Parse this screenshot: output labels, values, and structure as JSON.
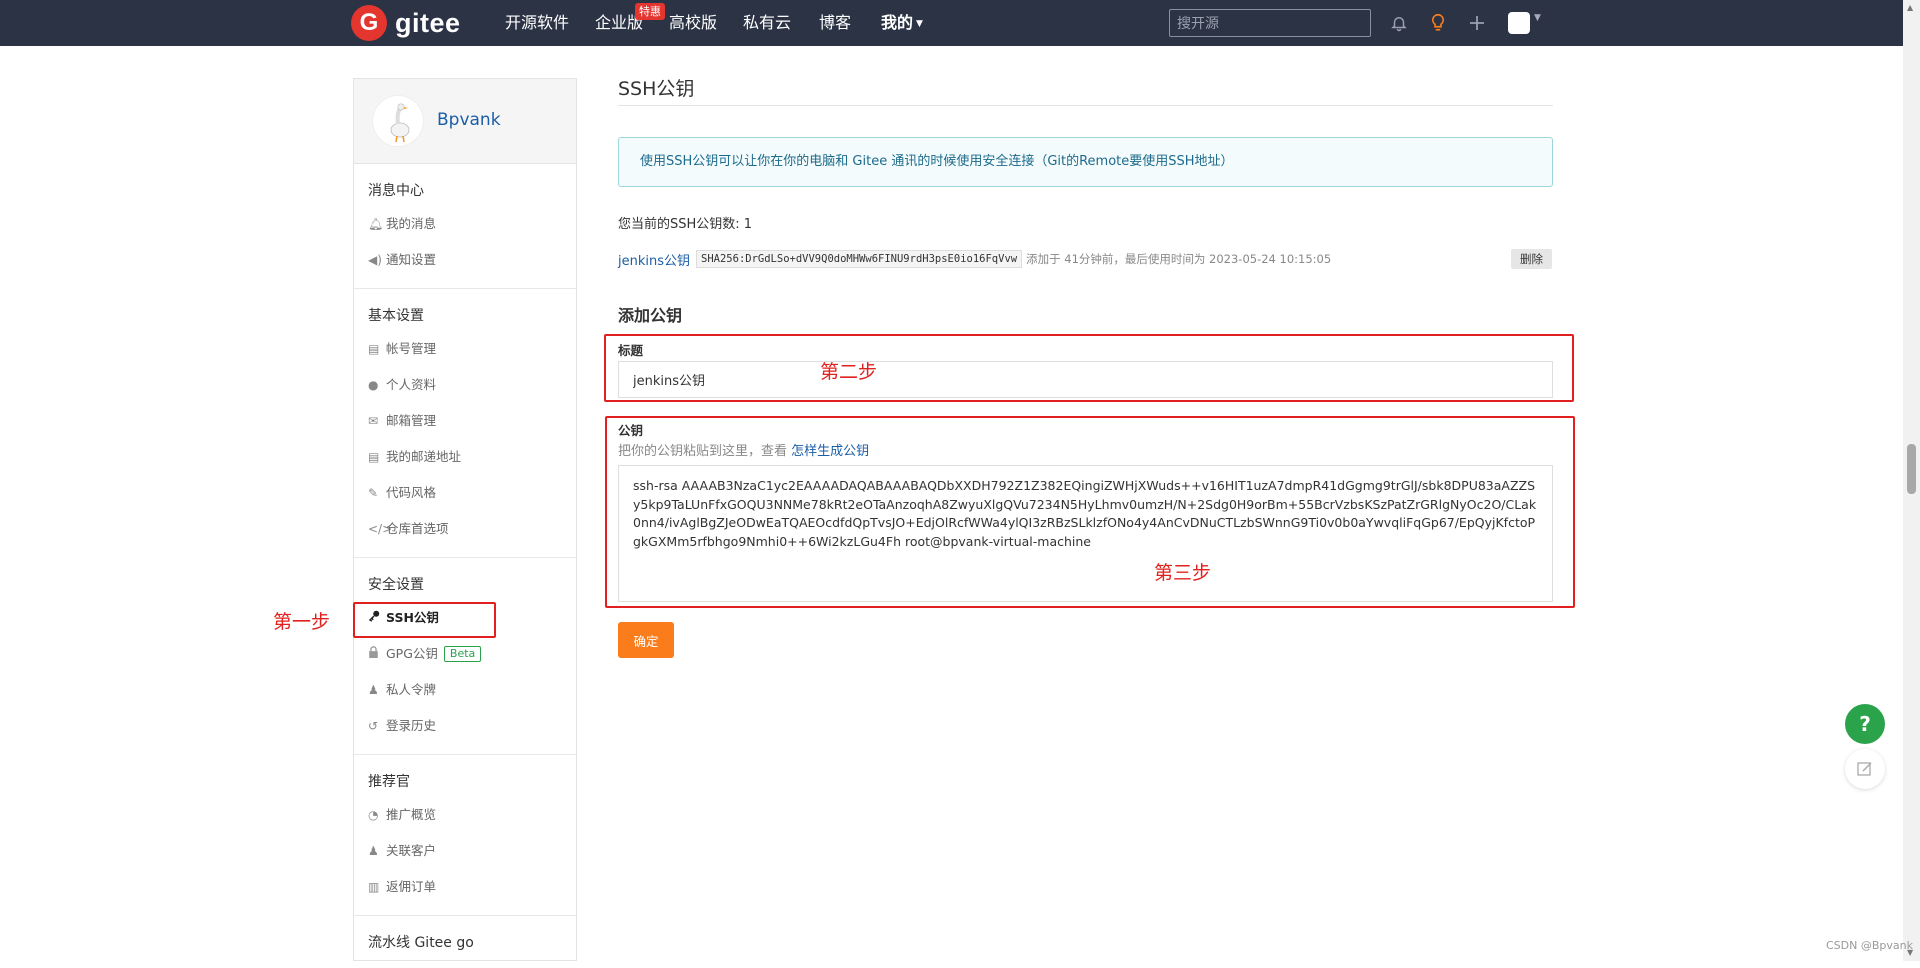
{
  "nav": {
    "logo_letter": "G",
    "logo_text": "gitee",
    "links": [
      "开源软件",
      "企业版",
      "高校版",
      "私有云",
      "博客"
    ],
    "hot_badge": "特惠",
    "mine_label": "我的",
    "search_placeholder": "搜开源"
  },
  "sidebar": {
    "username": "Bpvank",
    "groups": [
      {
        "title": "消息中心",
        "items": [
          {
            "label": "我的消息",
            "icon": "bell-icon"
          },
          {
            "label": "通知设置",
            "icon": "volume-icon"
          }
        ]
      },
      {
        "title": "基本设置",
        "items": [
          {
            "label": "帐号管理",
            "icon": "id-card-icon"
          },
          {
            "label": "个人资料",
            "icon": "user-icon"
          },
          {
            "label": "邮箱管理",
            "icon": "mail-icon"
          },
          {
            "label": "我的邮递地址",
            "icon": "address-card-icon"
          },
          {
            "label": "代码风格",
            "icon": "brush-icon"
          },
          {
            "label": "仓库首选项",
            "icon": "code-icon"
          }
        ]
      },
      {
        "title": "安全设置",
        "items": [
          {
            "label": "SSH公钥",
            "icon": "key-icon",
            "active": true
          },
          {
            "label": "GPG公钥",
            "icon": "lock-icon",
            "badge": "Beta"
          },
          {
            "label": "私人令牌",
            "icon": "token-icon"
          },
          {
            "label": "登录历史",
            "icon": "history-icon"
          }
        ]
      },
      {
        "title": "推荐官",
        "items": [
          {
            "label": "推广概览",
            "icon": "gauge-icon"
          },
          {
            "label": "关联客户",
            "icon": "user-link-icon"
          },
          {
            "label": "返佣订单",
            "icon": "order-icon"
          }
        ]
      },
      {
        "title": "流水线 Gitee go",
        "items": []
      }
    ]
  },
  "main": {
    "page_title": "SSH公钥",
    "info_text": "使用SSH公钥可以让你在你的电脑和 Gitee 通讯的时候使用安全连接（Git的Remote要使用SSH地址）",
    "key_count_text": "您当前的SSH公钥数: 1",
    "existing_key": {
      "name": "jenkins公钥",
      "fingerprint": "SHA256:DrGdLSo+dVV9Q0doMHWw6FINU9rdH3psE0io16FqVvw",
      "meta": "添加于 41分钟前，最后使用时间为 2023-05-24 10:15:05",
      "delete_label": "删除"
    },
    "add_title": "添加公钥",
    "title_label": "标题",
    "title_value": "jenkins公钥",
    "key_label": "公钥",
    "key_hint": "把你的公钥粘贴到这里，查看",
    "key_hint_link": "怎样生成公钥",
    "key_value": "ssh-rsa AAAAB3NzaC1yc2EAAAADAQABAAABAQDbXXDH792Z1Z382EQingiZWHjXWuds++v16HIT1uzA7dmpR41dGgmg9trGlJ/sbk8DPU83aAZZSy5kp9TaLUnFfxGOQU3NNMe78kRt2eOTaAnzoqhA8ZwyuXlgQVu7234N5HyLhmv0umzH/N+2Sdg0H9orBm+55BcrVzbsKSzPatZrGRlgNyOc2O/CLak0nn4/ivAglBgZJeODwEaTQAEOcdfdQpTvsJO+EdjOlRcfWWa4ylQI3zRBzSLklzfONo4y4AnCvDNuCTLzbSWnnG9Ti0v0b0aYwvqliFqGp67/EpQyjKfctoPgkGXMm5rfbhgo9Nmhi0++6Wi2kzLGu4Fh root@bpvank-virtual-machine",
    "submit_label": "确定"
  },
  "annotations": {
    "step1": "第一步",
    "step2": "第二步",
    "step3": "第三步"
  },
  "float": {
    "help": "?"
  },
  "watermark": "CSDN @Bpvank"
}
